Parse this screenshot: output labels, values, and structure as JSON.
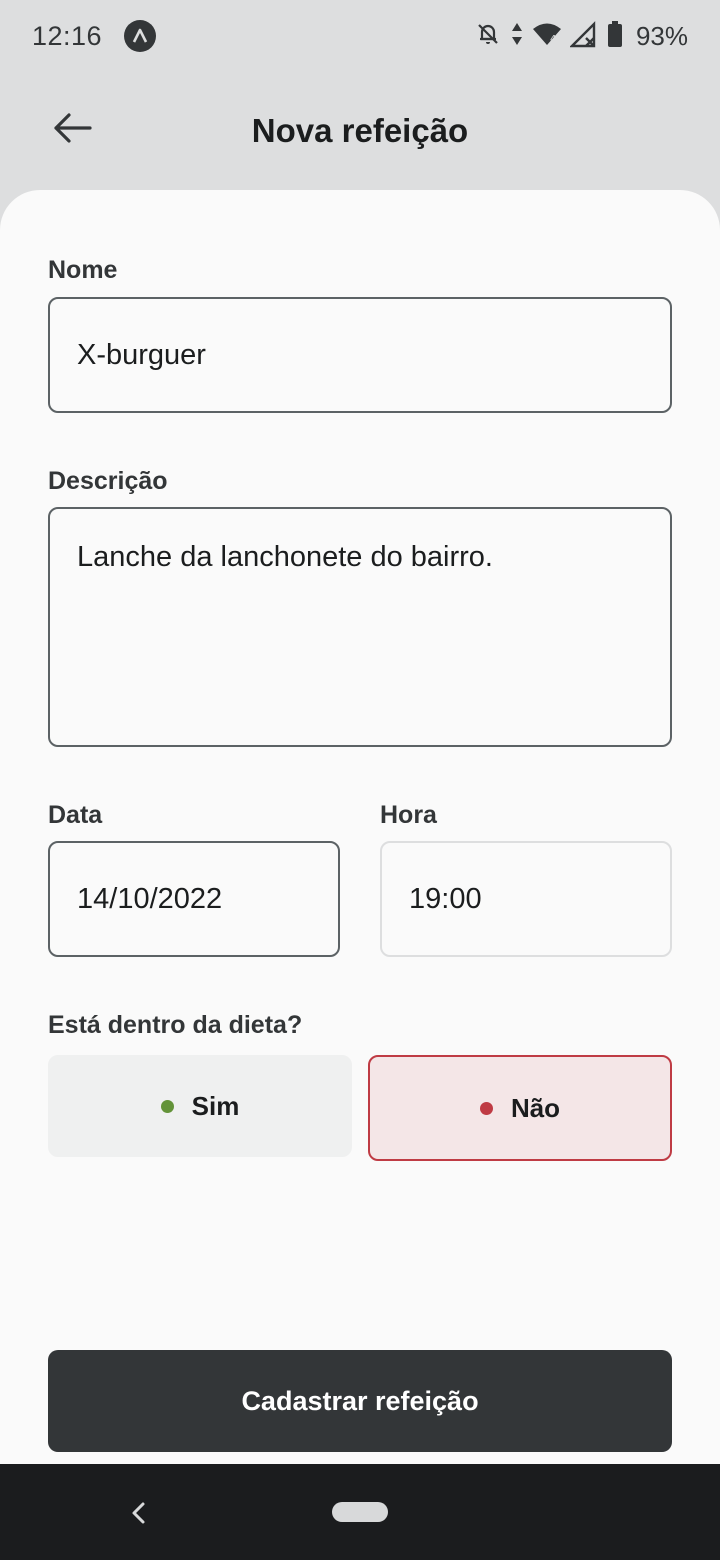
{
  "status_bar": {
    "time": "12:16",
    "battery": "93%",
    "icons": [
      "app-badge-icon",
      "bell-off-icon",
      "data-arrows-icon",
      "wifi-icon",
      "signal-icon",
      "battery-icon"
    ]
  },
  "header": {
    "title": "Nova refeição",
    "back_icon": "arrow-left-icon"
  },
  "form": {
    "name": {
      "label": "Nome",
      "value": "X-burguer"
    },
    "description": {
      "label": "Descrição",
      "value": "Lanche da lanchonete do bairro."
    },
    "date": {
      "label": "Data",
      "value": "14/10/2022"
    },
    "time": {
      "label": "Hora",
      "value": "19:00"
    },
    "diet": {
      "label": "Está dentro da dieta?",
      "yes": {
        "label": "Sim",
        "color": "#639339"
      },
      "no": {
        "label": "Não",
        "color": "#BF3B44",
        "selected": true
      }
    }
  },
  "submit": {
    "label": "Cadastrar refeição"
  },
  "colors": {
    "background": "#DDDEDF",
    "card": "#FAFAFA",
    "dark": "#333638",
    "red": "#BF3B44",
    "green": "#639339"
  }
}
